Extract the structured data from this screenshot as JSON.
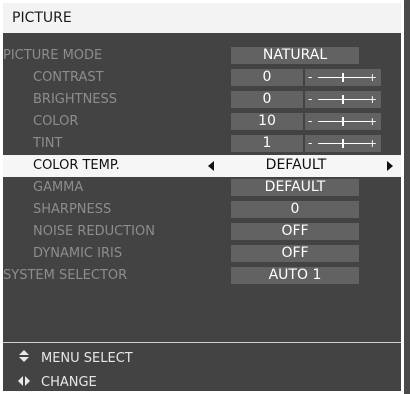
{
  "title": "PICTURE",
  "rows": [
    {
      "label": "PICTURE MODE",
      "value": "NATURAL",
      "type": "select"
    },
    {
      "label": "CONTRAST",
      "value": "0",
      "type": "slider",
      "slider_level": 0.5
    },
    {
      "label": "BRIGHTNESS",
      "value": "0",
      "type": "slider",
      "slider_level": 0.5
    },
    {
      "label": "COLOR",
      "value": "10",
      "type": "slider",
      "slider_level": 0.5
    },
    {
      "label": "TINT",
      "value": "1",
      "type": "slider",
      "slider_level": 0.5
    },
    {
      "label": "COLOR TEMP.",
      "value": "DEFAULT",
      "type": "select",
      "selected": true
    },
    {
      "label": "GAMMA",
      "value": "DEFAULT",
      "type": "select"
    },
    {
      "label": "SHARPNESS",
      "value": "0",
      "type": "select"
    },
    {
      "label": "NOISE REDUCTION",
      "value": "OFF",
      "type": "select"
    },
    {
      "label": "DYNAMIC IRIS",
      "value": "OFF",
      "type": "select"
    },
    {
      "label": "SYSTEM SELECTOR",
      "value": "AUTO 1",
      "type": "select"
    }
  ],
  "help": {
    "menu_select": "MENU SELECT",
    "change": "CHANGE"
  },
  "slider_minus": "-",
  "slider_plus": "+",
  "icons": {
    "menu_select": "up-down-arrow-icon",
    "change": "left-right-arrow-icon"
  },
  "colors": {
    "background": "#434343",
    "highlight": "#f6f6f6",
    "value_box": "#626262",
    "label_text": "#8d8d8d"
  }
}
